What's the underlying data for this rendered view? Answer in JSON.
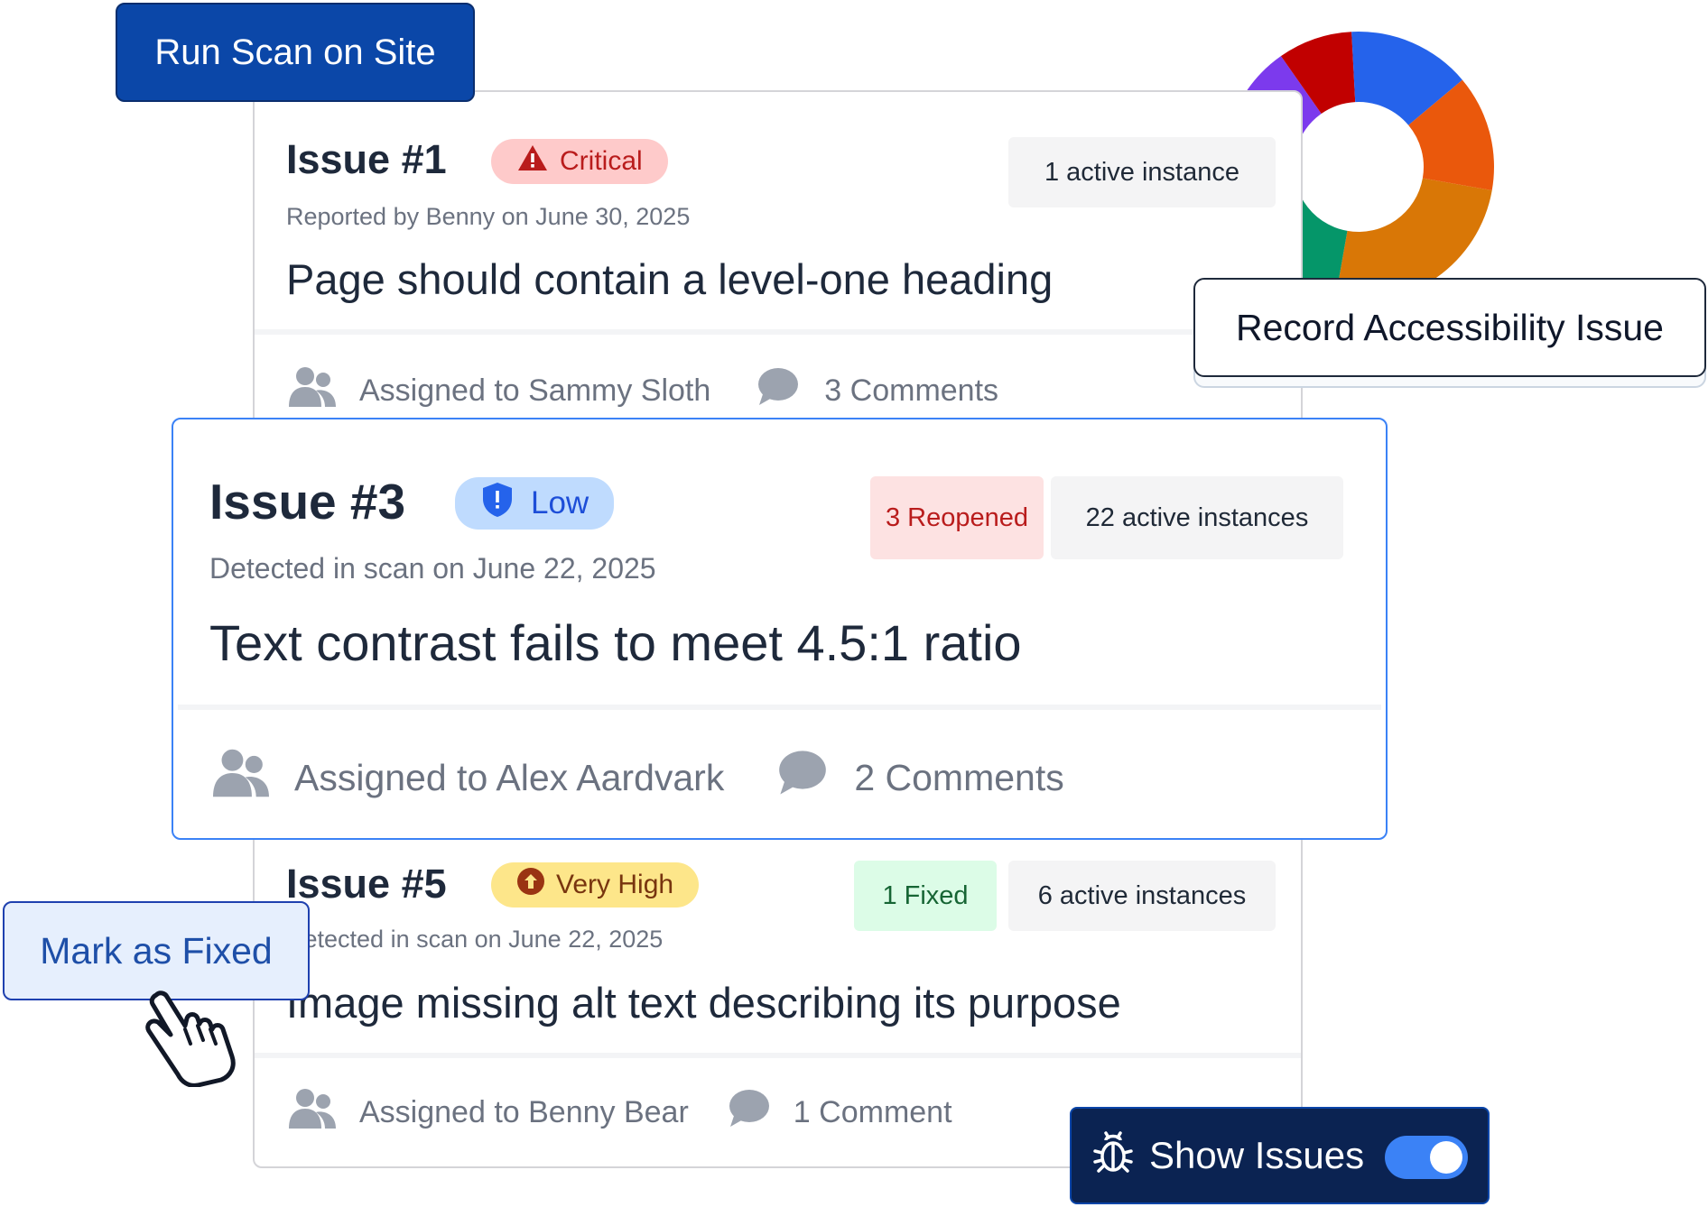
{
  "colors": {
    "primary": "#0b47a8",
    "highlight_border": "#3b82f6",
    "critical_bg": "#fecaca",
    "critical_text": "#b91c1c",
    "low_bg": "#bfdbfe",
    "low_text": "#1d4ed8",
    "very_high_bg": "#fde68a",
    "very_high_text": "#78350f",
    "reopened_bg": "#fde2e2",
    "fixed_bg": "#dcfce7",
    "donut": [
      "#ea580c",
      "#059669",
      "#7c3aed",
      "#c10000",
      "#2563eb",
      "#d97706"
    ]
  },
  "buttons": {
    "run_scan": "Run Scan on Site",
    "record_issue": "Record Accessibility Issue",
    "mark_fixed": "Mark as Fixed",
    "show_issues": "Show Issues",
    "show_issues_on": true
  },
  "issues": [
    {
      "title": "Issue #1",
      "severity": "Critical",
      "severity_icon": "warning-triangle-icon",
      "meta": "Reported by Benny on June 30, 2025",
      "description": "Page should contain a level-one heading",
      "chips": [
        "1 active instance"
      ],
      "assignee": "Assigned to Sammy Sloth",
      "comments": "3 Comments"
    },
    {
      "title": "Issue #3",
      "severity": "Low",
      "severity_icon": "shield-icon",
      "meta": "Detected in scan on June 22, 2025",
      "description": "Text contrast fails to meet 4.5:1 ratio",
      "chips": [
        "3 Reopened",
        "22 active instances"
      ],
      "assignee": "Assigned to Alex Aardvark",
      "comments": "2 Comments"
    },
    {
      "title": "Issue #5",
      "severity": "Very High",
      "severity_icon": "arrow-up-circle-icon",
      "meta": "Detected in scan on June 22, 2025",
      "description": "Image missing alt text describing its purpose",
      "chips": [
        "1 Fixed",
        "6 active instances"
      ],
      "assignee": "Assigned to Benny Bear",
      "comments": "1 Comment"
    }
  ]
}
